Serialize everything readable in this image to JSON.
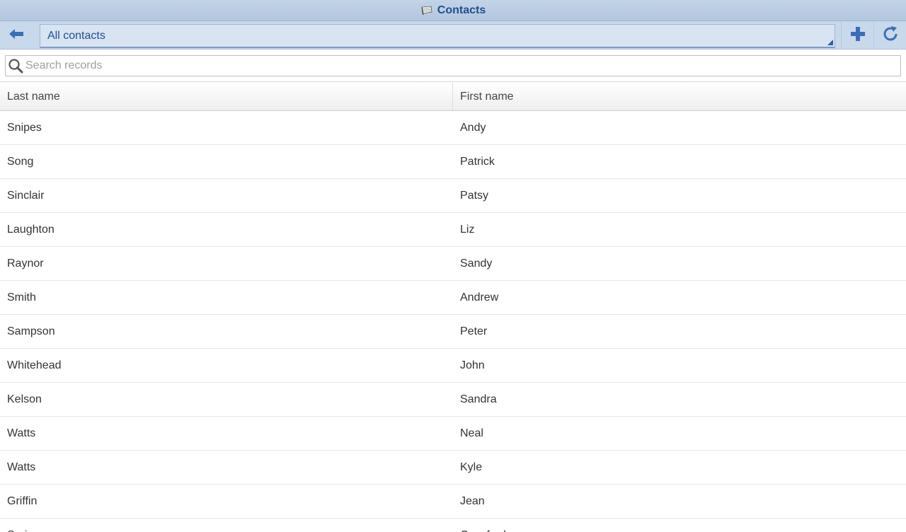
{
  "window": {
    "title": "Contacts",
    "app_icon": "flag-icon"
  },
  "toolbar": {
    "back_icon": "arrow-left-icon",
    "view_selected": "All contacts",
    "add_icon": "plus-icon",
    "refresh_icon": "refresh-icon",
    "accent_color": "#3a6fb5"
  },
  "search": {
    "placeholder": "Search records",
    "value": ""
  },
  "table": {
    "columns": [
      "Last name",
      "First name"
    ],
    "rows": [
      [
        "Snipes",
        "Andy"
      ],
      [
        "Song",
        "Patrick"
      ],
      [
        "Sinclair",
        "Patsy"
      ],
      [
        "Laughton",
        "Liz"
      ],
      [
        "Raynor",
        "Sandy"
      ],
      [
        "Smith",
        "Andrew"
      ],
      [
        "Sampson",
        "Peter"
      ],
      [
        "Whitehead",
        "John"
      ],
      [
        "Kelson",
        "Sandra"
      ],
      [
        "Watts",
        "Neal"
      ],
      [
        "Watts",
        "Kyle"
      ],
      [
        "Griffin",
        "Jean"
      ],
      [
        "Spring",
        "Crawford"
      ]
    ]
  }
}
